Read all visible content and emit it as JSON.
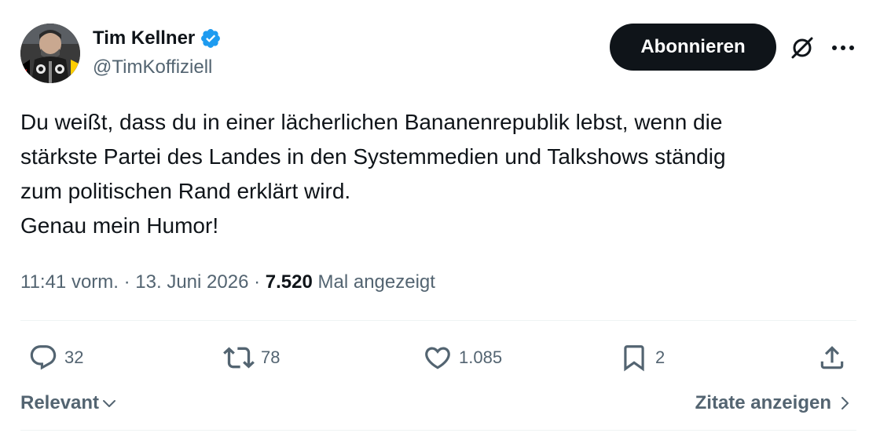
{
  "author": {
    "display_name": "Tim Kellner",
    "handle": "@TimKoffiziell",
    "verified": true
  },
  "header": {
    "follow_label": "Abonnieren",
    "grok_icon": "grok-icon",
    "more_icon": "more-icon"
  },
  "tweet": {
    "lines": [
      "Du weißt, dass du in einer lächerlichen Bananenrepublik lebst, wenn die",
      "stärkste Partei des Landes in den Systemmedien und Talkshows ständig",
      "zum politischen Rand erklärt wird.",
      "Genau mein Humor!"
    ]
  },
  "meta": {
    "time": "11:41 vorm.",
    "separator": "·",
    "date": "13. Juni 2026",
    "views_count": "7.520",
    "views_label": "Mal angezeigt"
  },
  "actions": {
    "replies": "32",
    "reposts": "78",
    "likes": "1.085",
    "bookmarks": "2"
  },
  "footer": {
    "sort_label": "Relevant",
    "quotes_label": "Zitate anzeigen"
  },
  "colors": {
    "text_primary": "#0f1419",
    "text_secondary": "#536471",
    "verified_blue": "#1d9bf0",
    "button_bg": "#0f1419",
    "divider": "#eff3f4"
  }
}
